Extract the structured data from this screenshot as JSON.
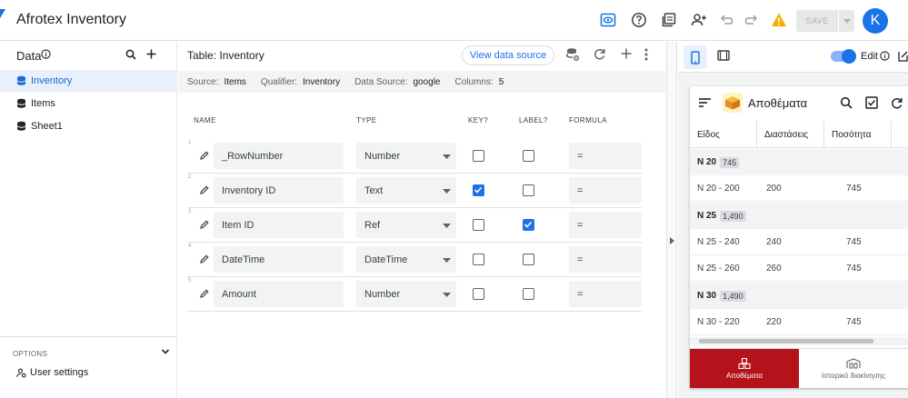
{
  "app": {
    "title": "Afrotex Inventory",
    "save_label": "SAVE",
    "avatar_letter": "K"
  },
  "sidebar": {
    "title": "Data",
    "items": [
      {
        "label": "Inventory",
        "icon": "database-icon",
        "active": true
      },
      {
        "label": "Items",
        "icon": "database-icon",
        "active": false
      },
      {
        "label": "Sheet1",
        "icon": "database-icon",
        "active": false
      }
    ],
    "options_label": "OPTIONS",
    "user_settings_label": "User settings"
  },
  "main": {
    "table_title": "Table: Inventory",
    "view_source_label": "View data source",
    "info": {
      "source_key": "Source:",
      "source_val": "Items",
      "qualifier_key": "Qualifier:",
      "qualifier_val": "Inventory",
      "datasource_key": "Data Source:",
      "datasource_val": "google",
      "columns_key": "Columns:",
      "columns_val": "5"
    },
    "headers": {
      "name": "NAME",
      "type": "TYPE",
      "key": "KEY?",
      "label": "LABEL?",
      "formula": "FORMULA"
    },
    "rows": [
      {
        "idx": "1",
        "name": "_RowNumber",
        "type": "Number",
        "key": false,
        "label": false,
        "formula": "="
      },
      {
        "idx": "2",
        "name": "Inventory ID",
        "type": "Text",
        "key": true,
        "label": false,
        "formula": "="
      },
      {
        "idx": "3",
        "name": "Item ID",
        "type": "Ref",
        "key": false,
        "label": true,
        "formula": "="
      },
      {
        "idx": "4",
        "name": "DateTime",
        "type": "DateTime",
        "key": false,
        "label": false,
        "formula": "="
      },
      {
        "idx": "5",
        "name": "Amount",
        "type": "Number",
        "key": false,
        "label": false,
        "formula": "="
      }
    ]
  },
  "preview": {
    "edit_label": "Edit",
    "edit_on": true,
    "app_title": "Αποθέματα",
    "columns": [
      "Είδος",
      "Διαστάσεις",
      "Ποσότητα"
    ],
    "groups": [
      {
        "name": "N 20",
        "count": "745",
        "rows": [
          {
            "item": "N 20 - 200",
            "dim": "200",
            "qty": "745"
          }
        ]
      },
      {
        "name": "N 25",
        "count": "1,490",
        "rows": [
          {
            "item": "N 25 - 240",
            "dim": "240",
            "qty": "745"
          },
          {
            "item": "N 25 - 260",
            "dim": "260",
            "qty": "745"
          }
        ]
      },
      {
        "name": "N 30",
        "count": "1,490",
        "rows": [
          {
            "item": "N 30 - 220",
            "dim": "220",
            "qty": "745"
          }
        ]
      }
    ],
    "tabs": [
      {
        "label": "Αποθέματα",
        "active": true
      },
      {
        "label": "Ιστορικό διακίνησης",
        "active": false
      }
    ]
  },
  "colors": {
    "accent": "#1a73e8",
    "active_tab": "#b5121b",
    "warning": "#f9ab00"
  }
}
